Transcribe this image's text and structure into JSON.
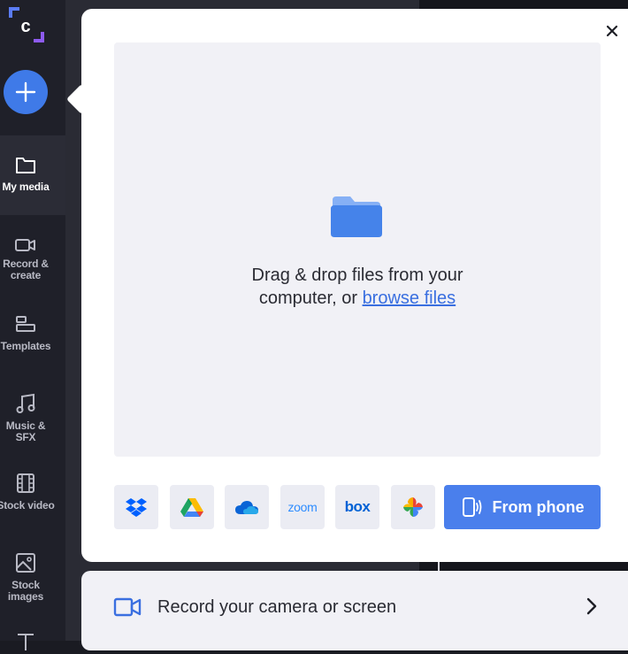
{
  "app": {
    "logo_letter": "c"
  },
  "sidebar": {
    "items": [
      {
        "label": "My media",
        "icon": "folder-icon",
        "active": true
      },
      {
        "label": "Record & create",
        "icon": "camera-icon",
        "active": false
      },
      {
        "label": "Templates",
        "icon": "templates-icon",
        "active": false
      },
      {
        "label": "Music & SFX",
        "icon": "music-icon",
        "active": false
      },
      {
        "label": "Stock video",
        "icon": "film-icon",
        "active": false
      },
      {
        "label": "Stock images",
        "icon": "image-icon",
        "active": false
      }
    ]
  },
  "upload": {
    "drop_text": "Drag & drop files from your computer, or",
    "browse_label": "browse files",
    "sources": [
      {
        "name": "dropbox",
        "icon": "dropbox-icon"
      },
      {
        "name": "google-drive",
        "icon": "google-drive-icon"
      },
      {
        "name": "onedrive",
        "icon": "onedrive-icon"
      },
      {
        "name": "zoom",
        "label": "zoom",
        "icon": "zoom-icon"
      },
      {
        "name": "box",
        "label": "box",
        "icon": "box-icon"
      },
      {
        "name": "google-photos",
        "icon": "google-photos-icon"
      }
    ],
    "from_phone_label": "From phone"
  },
  "record": {
    "label": "Record your camera or screen"
  },
  "colors": {
    "accent": "#4a7fec",
    "link": "#3a6fe0",
    "sidebar_bg": "#1f2029"
  }
}
